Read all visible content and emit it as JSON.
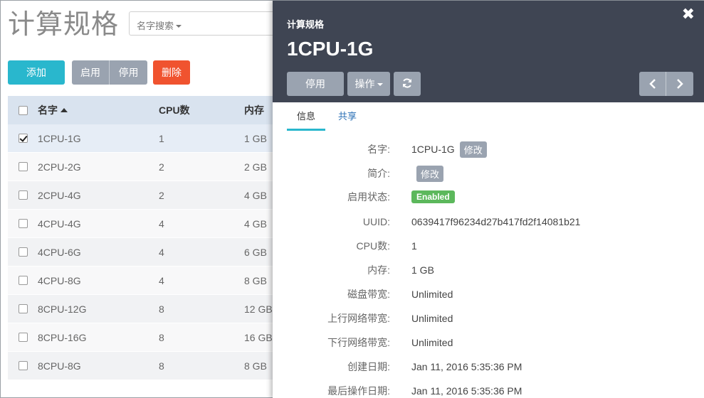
{
  "page": {
    "title": "计算规格",
    "search_dropdown": "名字搜索",
    "buttons": {
      "add": "添加",
      "enable": "启用",
      "disable": "停用",
      "delete": "删除"
    }
  },
  "table": {
    "headers": {
      "name": "名字",
      "cpu": "CPU数",
      "memory": "内存"
    },
    "rows": [
      {
        "name": "1CPU-1G",
        "cpu": "1",
        "memory": "1 GB",
        "checked": true
      },
      {
        "name": "2CPU-2G",
        "cpu": "2",
        "memory": "2 GB",
        "checked": false
      },
      {
        "name": "2CPU-4G",
        "cpu": "2",
        "memory": "4 GB",
        "checked": false
      },
      {
        "name": "4CPU-4G",
        "cpu": "4",
        "memory": "4 GB",
        "checked": false
      },
      {
        "name": "4CPU-6G",
        "cpu": "4",
        "memory": "6 GB",
        "checked": false
      },
      {
        "name": "4CPU-8G",
        "cpu": "4",
        "memory": "8 GB",
        "checked": false
      },
      {
        "name": "8CPU-12G",
        "cpu": "8",
        "memory": "12 GB",
        "checked": false
      },
      {
        "name": "8CPU-16G",
        "cpu": "8",
        "memory": "16 GB",
        "checked": false
      },
      {
        "name": "8CPU-8G",
        "cpu": "8",
        "memory": "8 GB",
        "checked": false
      }
    ]
  },
  "panel": {
    "crumb": "计算规格",
    "title": "1CPU-1G",
    "close_icon": "✖",
    "buttons": {
      "disable": "停用",
      "operations": "操作"
    },
    "tabs": {
      "info": "信息",
      "share": "共享"
    },
    "details": {
      "name_label": "名字:",
      "name_value": "1CPU-1G",
      "edit_label": "修改",
      "desc_label": "简介:",
      "desc_edit_label": "修改",
      "status_label": "启用状态:",
      "status_value": "Enabled",
      "uuid_label": "UUID:",
      "uuid_value": "0639417f96234d27b417fd2f14081b21",
      "cpu_label": "CPU数:",
      "cpu_value": "1",
      "mem_label": "内存:",
      "mem_value": "1 GB",
      "disk_bw_label": "磁盘带宽:",
      "disk_bw_value": "Unlimited",
      "up_bw_label": "上行网络带宽:",
      "up_bw_value": "Unlimited",
      "down_bw_label": "下行网络带宽:",
      "down_bw_value": "Unlimited",
      "created_label": "创建日期:",
      "created_value": "Jan 11, 2016 5:35:36 PM",
      "last_op_label": "最后操作日期:",
      "last_op_value": "Jan 11, 2016 5:35:36 PM"
    }
  },
  "colors": {
    "accent": "#29b7cd",
    "danger": "#f0532f",
    "header": "#3f4553",
    "success": "#5cb85c",
    "neutral_button": "#9aa3b0"
  }
}
